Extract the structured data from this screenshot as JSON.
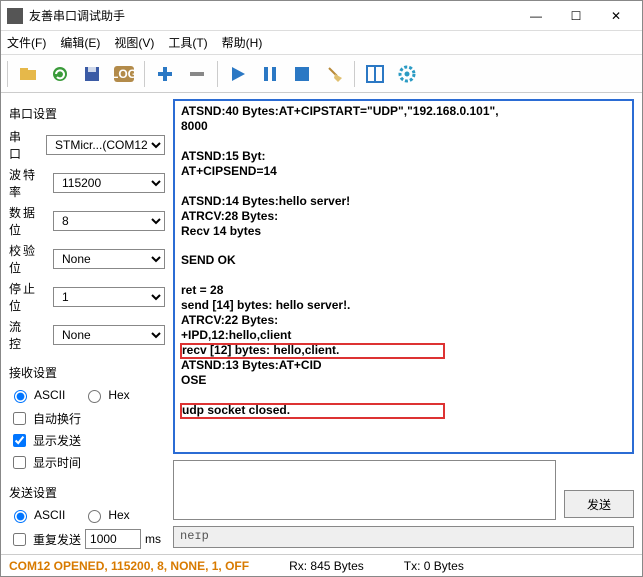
{
  "window": {
    "title": "友善串口调试助手"
  },
  "menu": {
    "file": "文件(F)",
    "edit": "编辑(E)",
    "view": "视图(V)",
    "tools": "工具(T)",
    "help": "帮助(H)"
  },
  "panel": {
    "serial_title": "串口设置",
    "port_label": "串　口",
    "port_value": "STMicr...(COM12",
    "baud_label": "波特率",
    "baud_value": "115200",
    "databits_label": "数据位",
    "databits_value": "8",
    "parity_label": "校验位",
    "parity_value": "None",
    "stopbits_label": "停止位",
    "stopbits_value": "1",
    "flow_label": "流　控",
    "flow_value": "None",
    "recv_title": "接收设置",
    "ascii": "ASCII",
    "hex": "Hex",
    "autowrap": "自动换行",
    "showsend": "显示发送",
    "showtime": "显示时间",
    "send_title": "发送设置",
    "repeat": "重复发送",
    "repeat_value": "1000",
    "ms": "ms"
  },
  "output": {
    "l1": "ATSND:40 Bytes:AT+CIPSTART=\"UDP\",\"192.168.0.101\",",
    "l2": "8000",
    "l3": "",
    "l4": "ATSND:15 Byt:",
    "l5": "AT+CIPSEND=14",
    "l6": "",
    "l7": "ATSND:14 Bytes:hello server!",
    "l8": "ATRCV:28 Bytes:",
    "l9": "Recv 14 bytes",
    "l10": "",
    "l11": "SEND OK",
    "l12": "",
    "l13": "ret = 28",
    "l14": "send [14] bytes: hello server!.",
    "l15": "ATRCV:22 Bytes:",
    "l16": "+IPD,12:hello,client",
    "l17": "recv [12] bytes: hello,client.",
    "l18": "ATSND:13 Bytes:AT+CID",
    "l19": "OSE",
    "l20": "",
    "l21": "udp socket closed."
  },
  "send": {
    "button": "发送"
  },
  "helpbox": "neɪp",
  "status": {
    "com": "COM12 OPENED, 115200, 8, NONE, 1, OFF",
    "rx": "Rx: 845 Bytes",
    "tx": "Tx: 0 Bytes"
  }
}
